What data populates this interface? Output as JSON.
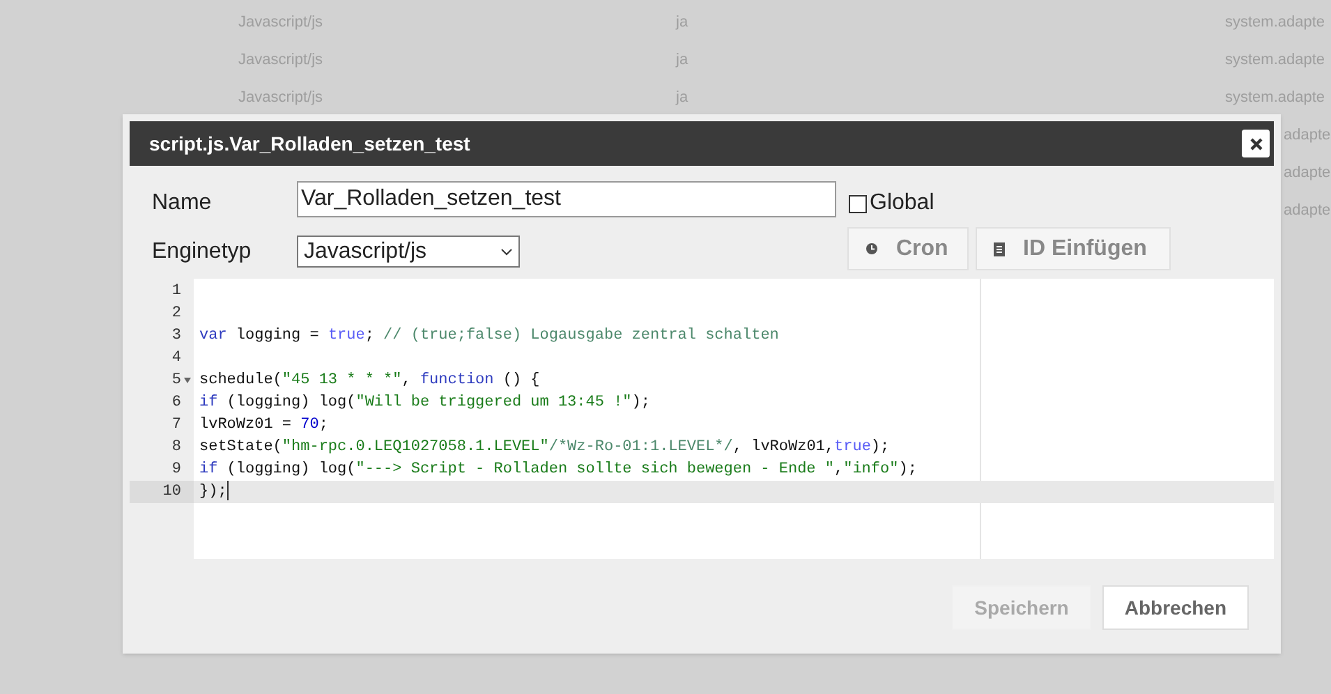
{
  "background_table": {
    "rows": [
      {
        "column_1": "Javascript/js",
        "column_2": "ja",
        "column_3": "system.adapte"
      },
      {
        "column_1": "Javascript/js",
        "column_2": "ja",
        "column_3": "system.adapte"
      },
      {
        "column_1": "Javascript/js",
        "column_2": "ja",
        "column_3": "system.adapte"
      },
      {
        "column_3": "adapte"
      },
      {
        "column_3": "adapte"
      },
      {
        "column_3": "adapte"
      }
    ]
  },
  "dialog": {
    "title": "script.js.Var_Rolladen_setzen_test",
    "name": {
      "label": "Name",
      "value": "Var_Rolladen_setzen_test"
    },
    "global": {
      "label": "Global",
      "checked": false
    },
    "engine": {
      "label": "Enginetyp",
      "value": "Javascript/js"
    },
    "tool_buttons": [
      {
        "label": "Cron"
      },
      {
        "label": "ID Einfügen"
      }
    ],
    "editor": {
      "lines": [
        {
          "number": "1"
        },
        {
          "number": "2"
        },
        {
          "number": "3",
          "tokens": [
            {
              "kind": "keyword",
              "text": "var"
            },
            {
              "kind": "plain",
              "text": " logging = "
            },
            {
              "kind": "bool",
              "text": "true"
            },
            {
              "kind": "plain",
              "text": "; "
            },
            {
              "kind": "comment",
              "text": "// (true;false) Logausgabe zentral schalten"
            }
          ]
        },
        {
          "number": "4"
        },
        {
          "number": "5",
          "fold": true,
          "tokens": [
            {
              "kind": "plain",
              "text": "schedule("
            },
            {
              "kind": "string",
              "text": "\"45 13 * * *\""
            },
            {
              "kind": "plain",
              "text": ", "
            },
            {
              "kind": "keyword",
              "text": "function"
            },
            {
              "kind": "plain",
              "text": " () {"
            }
          ]
        },
        {
          "number": "6",
          "tokens": [
            {
              "kind": "keyword",
              "text": "if"
            },
            {
              "kind": "plain",
              "text": " (logging) log("
            },
            {
              "kind": "string",
              "text": "\"Will be triggered um 13:45 !\""
            },
            {
              "kind": "plain",
              "text": ");"
            }
          ]
        },
        {
          "number": "7",
          "tokens": [
            {
              "kind": "plain",
              "text": "lvRoWz01 = "
            },
            {
              "kind": "number",
              "text": "70"
            },
            {
              "kind": "plain",
              "text": ";"
            }
          ]
        },
        {
          "number": "8",
          "tokens": [
            {
              "kind": "plain",
              "text": "setState("
            },
            {
              "kind": "string",
              "text": "\"hm-rpc.0.LEQ1027058.1.LEVEL\""
            },
            {
              "kind": "comment",
              "text": "/*Wz-Ro-01:1.LEVEL*/"
            },
            {
              "kind": "plain",
              "text": ", lvRoWz01,"
            },
            {
              "kind": "bool",
              "text": "true"
            },
            {
              "kind": "plain",
              "text": ");"
            }
          ]
        },
        {
          "number": "9",
          "tokens": [
            {
              "kind": "keyword",
              "text": "if"
            },
            {
              "kind": "plain",
              "text": " (logging) log("
            },
            {
              "kind": "string",
              "text": "\"---> Script - Rolladen sollte sich bewegen - Ende \""
            },
            {
              "kind": "plain",
              "text": ","
            },
            {
              "kind": "string",
              "text": "\"info\""
            },
            {
              "kind": "plain",
              "text": ");"
            }
          ]
        },
        {
          "number": "10",
          "active": true,
          "tokens": [
            {
              "kind": "plain",
              "text": "});"
            }
          ]
        }
      ]
    },
    "buttons": [
      {
        "label": "Speichern",
        "disabled": true
      },
      {
        "label": "Abbrechen",
        "disabled": false
      }
    ]
  }
}
